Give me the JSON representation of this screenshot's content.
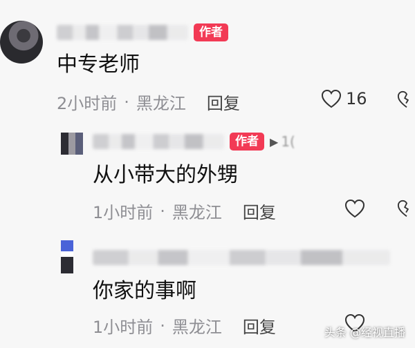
{
  "comments": [
    {
      "content": "中专老师",
      "author_badge": "作者",
      "time": "2小时前",
      "location": "黑龙江",
      "reply_label": "回复",
      "likes": "16",
      "dot": "·"
    },
    {
      "content": "从小带大的外甥",
      "author_badge": "作者",
      "reply_to": "1(",
      "time": "1小时前",
      "location": "黑龙江",
      "reply_label": "回复",
      "dot": "·"
    },
    {
      "content": "你家的事啊",
      "time": "1小时前",
      "location": "黑龙江",
      "reply_label": "回复",
      "dot": "·"
    }
  ],
  "watermark": "头条 @经视直播",
  "colors": {
    "badge": "#f23a55",
    "meta": "#8e8e93"
  },
  "icons": [
    "heart-icon",
    "dislike-icon",
    "reply-arrow-icon"
  ]
}
